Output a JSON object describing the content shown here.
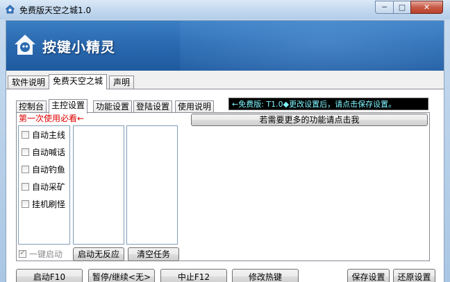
{
  "window": {
    "title": "免费版天空之城1.0",
    "controls": {
      "minimize": "─",
      "maximize": "□",
      "close": "✕"
    }
  },
  "banner": {
    "brand": "按键小精灵"
  },
  "outer_tabs": [
    "软件说明",
    "免费天空之城",
    "声明"
  ],
  "inner_tabs": [
    "控制台",
    "主控设置",
    "功能设置",
    "登陆设置",
    "使用说明"
  ],
  "ticker": "←免费版: T1.0◆更改设置后，请点击保存设置。",
  "panel": {
    "warning": "第一次使用必看←",
    "more_features_button": "若需要更多的功能请点击我",
    "checkboxes": [
      "自动主线",
      "自动喊话",
      "自动钓鱼",
      "自动采矿",
      "挂机刷怪"
    ],
    "one_key_start": "一键启动",
    "start_no_response_button": "启动无反应",
    "clear_tasks_button": "清空任务"
  },
  "bottom_buttons": {
    "start": "启动F10",
    "pause": "暂停/继续<无>",
    "stop": "中止F12",
    "hotkey": "修改热键",
    "save": "保存设置",
    "restore": "还原设置"
  },
  "colors": {
    "banner": "#2b6ab0",
    "ticker_bg": "#000000",
    "ticker_fg": "#7ff7ff",
    "warning": "#e00000"
  }
}
